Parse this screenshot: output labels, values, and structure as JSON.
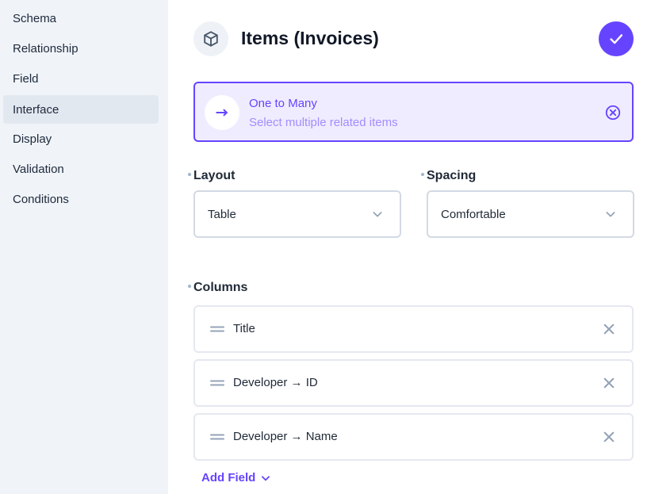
{
  "sidebar": {
    "items": [
      {
        "label": "Schema",
        "active": false
      },
      {
        "label": "Relationship",
        "active": false
      },
      {
        "label": "Field",
        "active": false
      },
      {
        "label": "Interface",
        "active": true
      },
      {
        "label": "Display",
        "active": false
      },
      {
        "label": "Validation",
        "active": false
      },
      {
        "label": "Conditions",
        "active": false
      }
    ]
  },
  "header": {
    "icon": "cube-icon",
    "title": "Items (Invoices)",
    "save_icon": "check-icon"
  },
  "relation": {
    "icon": "arrow-right-icon",
    "title": "One to Many",
    "subtitle": "Select multiple related items",
    "clear_icon": "close-circle-icon"
  },
  "layout": {
    "label": "Layout",
    "value": "Table"
  },
  "spacing": {
    "label": "Spacing",
    "value": "Comfortable"
  },
  "columns": {
    "label": "Columns",
    "items": [
      "Title",
      "Developer → ID",
      "Developer → Name"
    ],
    "add_label": "Add Field"
  },
  "colors": {
    "accent": "#6644ff",
    "accent_light": "#f0ecff",
    "sidebar_bg": "#f0f4f9",
    "sidebar_active": "#e2e8f0",
    "border": "#d3dae4"
  }
}
